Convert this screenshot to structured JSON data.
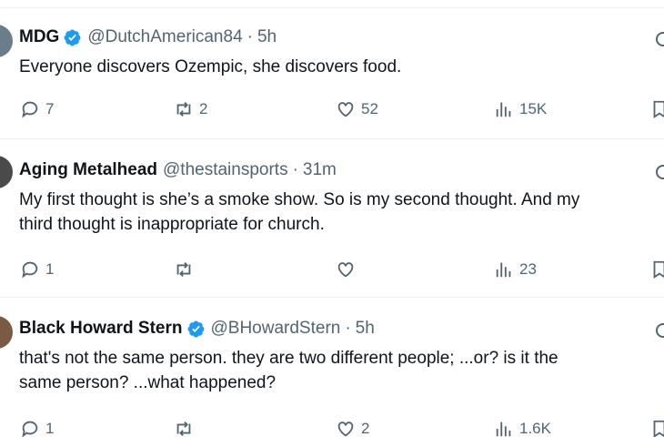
{
  "tweets": [
    {
      "name": "MDG",
      "verified": true,
      "handle": "@DutchAmerican84",
      "separator": "·",
      "time": "5h",
      "lines": [
        "Everyone discovers Ozempic, she discovers food."
      ],
      "replies": "7",
      "retweets": "2",
      "likes": "52",
      "views": "15K"
    },
    {
      "name": "Aging Metalhead",
      "verified": false,
      "handle": "@thestainsports",
      "separator": "·",
      "time": "31m",
      "lines": [
        "My first thought is she’s a smoke show. So is my second thought. And my",
        "third thought is inappropriate for church."
      ],
      "replies": "1",
      "retweets": "",
      "likes": "",
      "views": "23"
    },
    {
      "name": "Black Howard Stern",
      "verified": true,
      "handle": "@BHowardStern",
      "separator": "·",
      "time": "5h",
      "lines": [
        "that's not the same person. they are two different people; ...or? is it the",
        "same person? ...what happened?"
      ],
      "replies": "1",
      "retweets": "",
      "likes": "2",
      "views": "1.6K"
    }
  ],
  "colors": {
    "verified": "#1d9bf0",
    "muted": "#536471",
    "text": "#0f1419",
    "divider": "#eff3f4"
  },
  "icons": {
    "reply": "reply-icon",
    "retweet": "retweet-icon",
    "like": "heart-icon",
    "views": "views-icon",
    "bookmark": "bookmark-icon",
    "more": "grok-icon"
  }
}
